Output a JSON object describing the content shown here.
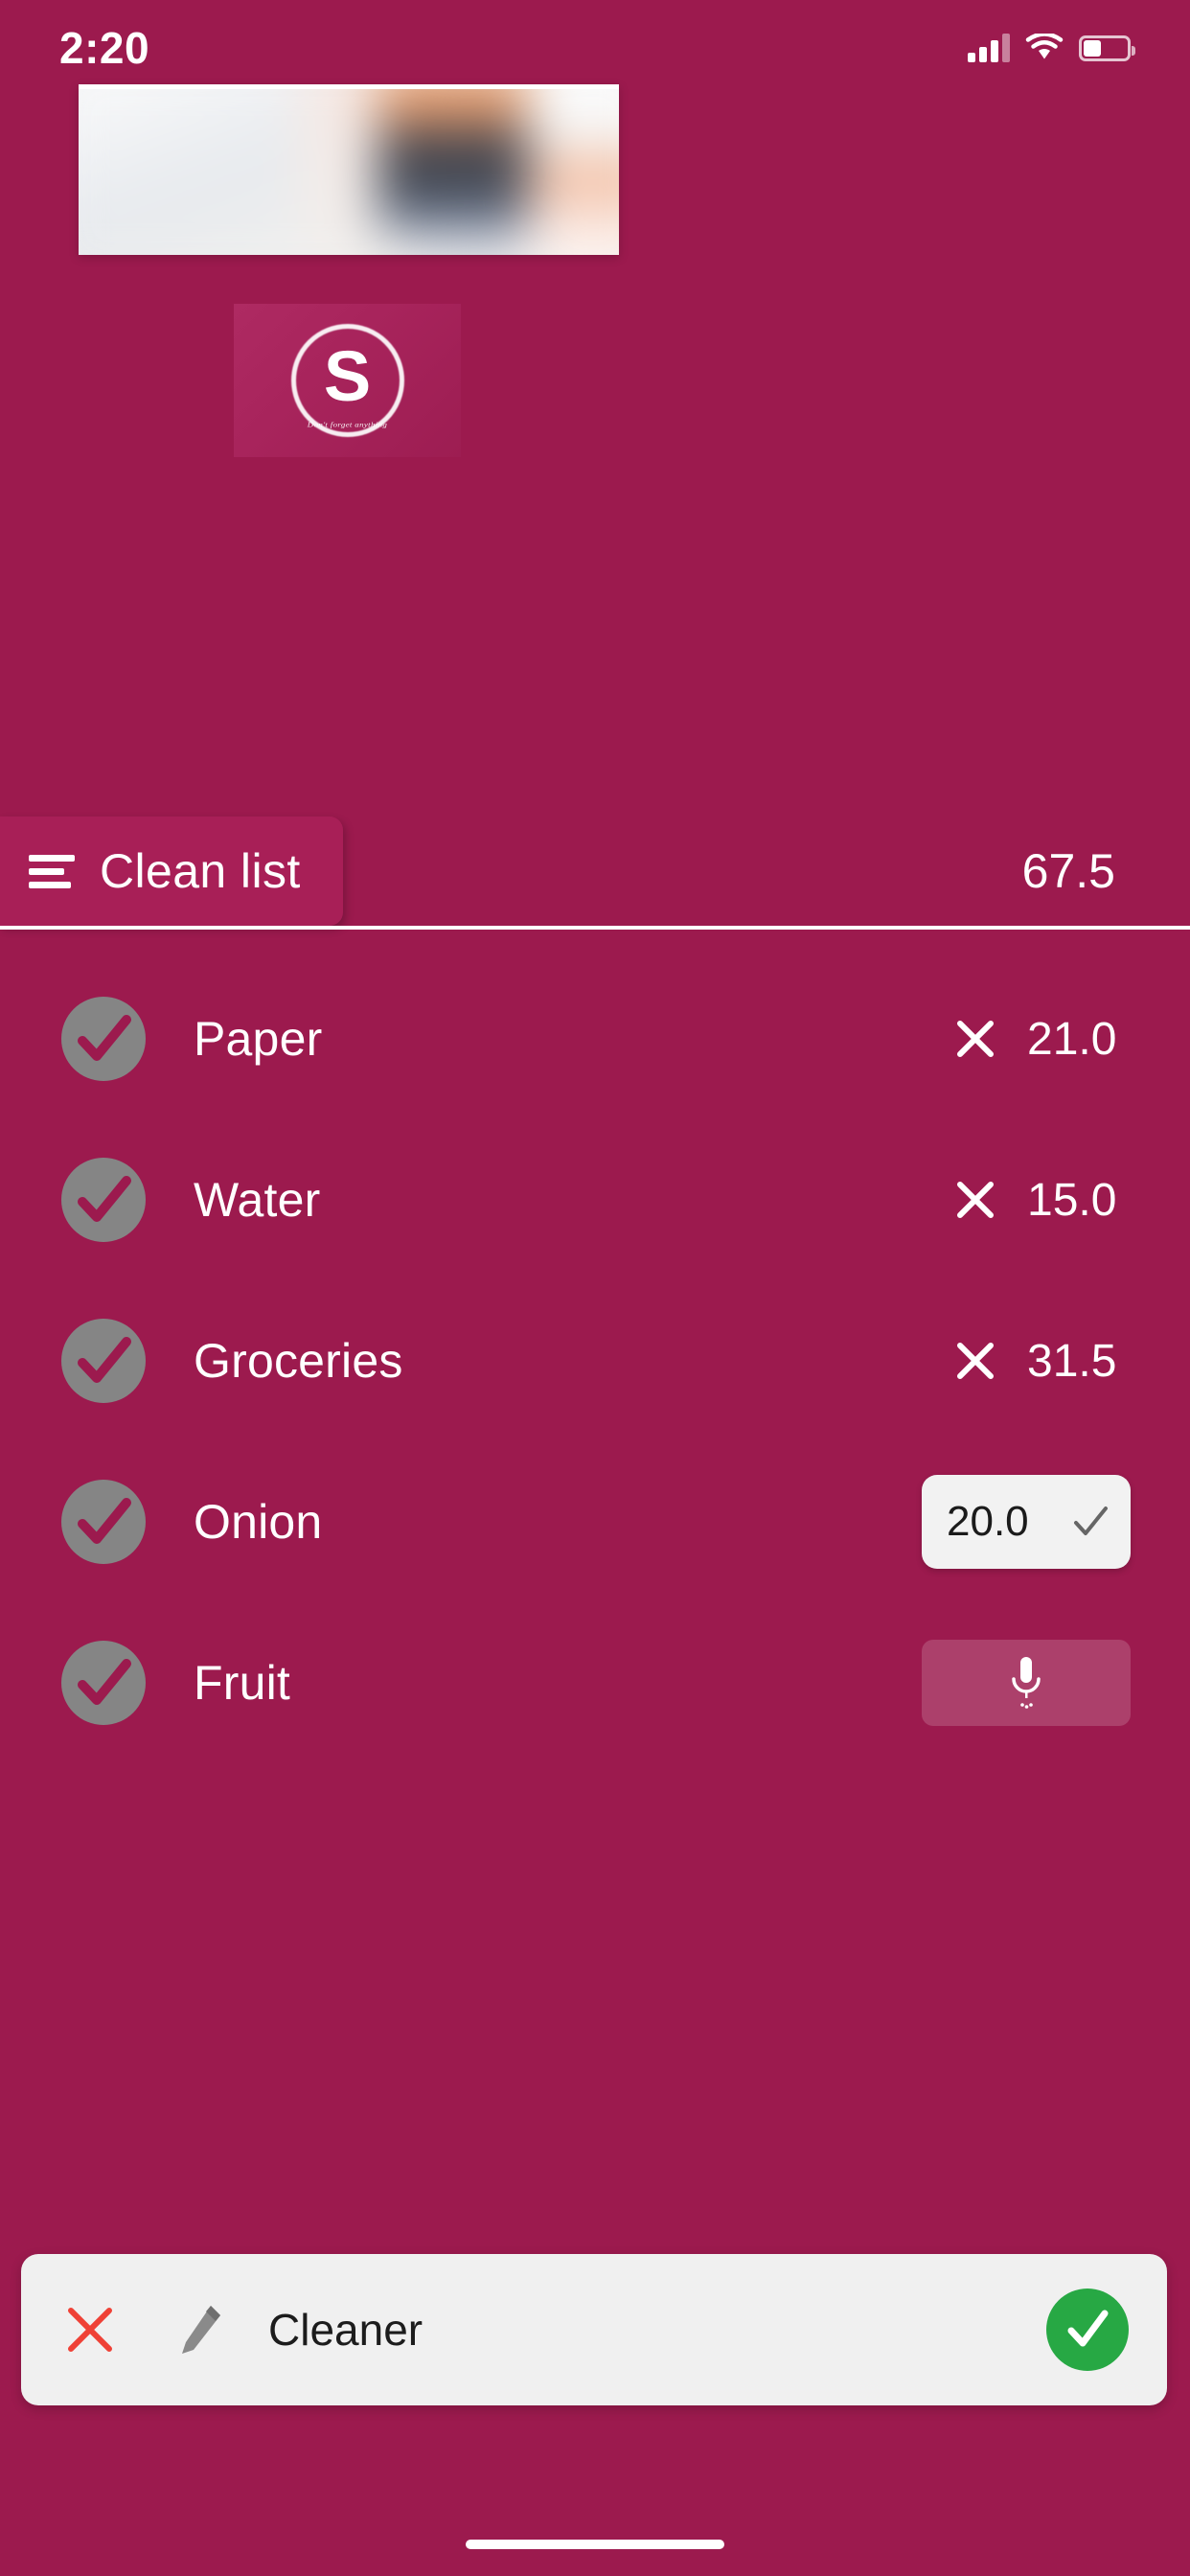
{
  "status_bar": {
    "time": "2:20",
    "signal_icon": "cellular-signal-icon",
    "wifi_icon": "wifi-icon",
    "battery_icon": "battery-icon",
    "battery_level_percent": 42
  },
  "banner": {
    "name": "blurred-photo-banner",
    "description": "blurred image preview"
  },
  "logo": {
    "letter": "S",
    "tagline": "Don't forget anything"
  },
  "list_header": {
    "menu_icon": "hamburger-menu-icon",
    "title": "Clean list",
    "total": "67.5"
  },
  "items": [
    {
      "name": "Paper",
      "checked": true,
      "value": "21.0",
      "control": "value",
      "remove_icon": "close-x-icon"
    },
    {
      "name": "Water",
      "checked": true,
      "value": "15.0",
      "control": "value",
      "remove_icon": "close-x-icon"
    },
    {
      "name": "Groceries",
      "checked": true,
      "value": "31.5",
      "control": "value",
      "remove_icon": "close-x-icon"
    },
    {
      "name": "Onion",
      "checked": true,
      "value": "20.0",
      "control": "input",
      "confirm_icon": "check-icon"
    },
    {
      "name": "Fruit",
      "checked": true,
      "value": "",
      "control": "microphone",
      "mic_icon": "microphone-icon"
    }
  ],
  "entry_bar": {
    "cancel_icon": "close-x-icon",
    "edit_icon": "pencil-icon",
    "text": "Cleaner",
    "confirm_icon": "check-circle-icon"
  },
  "colors": {
    "background": "#9C1A4E",
    "header_card": "#A81F57",
    "circle_gray": "#858585",
    "entry_bar_bg": "#F0F0F0",
    "confirm_green": "#27A844",
    "cancel_red": "#EF4136",
    "input_bg": "#F2F2F2"
  }
}
